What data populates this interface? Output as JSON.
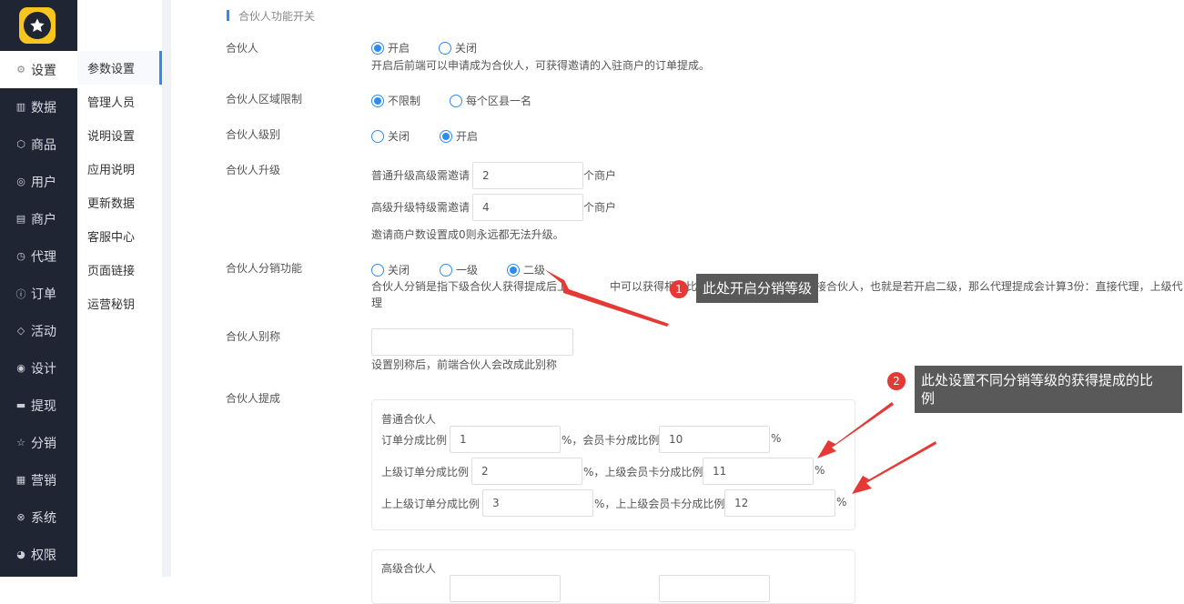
{
  "sidebar": {
    "items": [
      {
        "label": "设置",
        "icon": "gear-icon",
        "glyph": "⚙"
      },
      {
        "label": "数据",
        "icon": "bar-chart-icon",
        "glyph": "▥"
      },
      {
        "label": "商品",
        "icon": "cube-icon",
        "glyph": "⬡"
      },
      {
        "label": "用户",
        "icon": "user-icon",
        "glyph": "◎"
      },
      {
        "label": "商户",
        "icon": "store-icon",
        "glyph": "▤"
      },
      {
        "label": "代理",
        "icon": "clock-icon",
        "glyph": "◷"
      },
      {
        "label": "订单",
        "icon": "info-icon",
        "glyph": "ⓘ"
      },
      {
        "label": "活动",
        "icon": "tag-icon",
        "glyph": "◇"
      },
      {
        "label": "设计",
        "icon": "palette-icon",
        "glyph": "◉"
      },
      {
        "label": "提现",
        "icon": "card-icon",
        "glyph": "▬"
      },
      {
        "label": "分销",
        "icon": "star-icon",
        "glyph": "☆"
      },
      {
        "label": "营销",
        "icon": "grid-icon",
        "glyph": "▦"
      },
      {
        "label": "系统",
        "icon": "cross-circle-icon",
        "glyph": "⊗"
      },
      {
        "label": "权限",
        "icon": "compass-icon",
        "glyph": "◕"
      }
    ]
  },
  "submenu": {
    "items": [
      "参数设置",
      "管理人员",
      "说明设置",
      "应用说明",
      "更新数据",
      "客服中心",
      "页面链接",
      "运营秘钥"
    ]
  },
  "section_title": "合伙人功能开关",
  "partner": {
    "label": "合伙人",
    "options": [
      "开启",
      "关闭"
    ],
    "selected": 0,
    "hint": "开启后前端可以申请成为合伙人，可获得邀请的入驻商户的订单提成。"
  },
  "region_limit": {
    "label": "合伙人区域限制",
    "options": [
      "不限制",
      "每个区县一名"
    ],
    "selected": 0
  },
  "level": {
    "label": "合伙人级别",
    "options": [
      "关闭",
      "开启"
    ],
    "selected": 1
  },
  "upgrade": {
    "label": "合伙人升级",
    "normal_label": "普通升级高级需邀请",
    "normal_value": "2",
    "advanced_label": "高级升级特级需邀请",
    "advanced_value": "4",
    "unit": "个商户",
    "hint": "邀请商户数设置成0则永远都无法升级。"
  },
  "distribution": {
    "label": "合伙人分销功能",
    "options": [
      "关闭",
      "一级",
      "二级"
    ],
    "selected": 2,
    "hint_left": "合伙人分销是指下级合伙人获得提成后上",
    "hint_mid": "中可以获得相应比例",
    "hint_right": "接合伙人，也就是若开启二级，那么代理提成会计算3份：直接代理，上级代",
    "hint_line2": "理"
  },
  "alias": {
    "label": "合伙人别称",
    "value": "",
    "hint": "设置别称后，前端合伙人会改成此别称"
  },
  "commission": {
    "label": "合伙人提成",
    "normal": {
      "title": "普通合伙人",
      "order_label": "订单分成比例",
      "order_value": "1",
      "card_label": "%，会员卡分成比例",
      "card_value": "10",
      "up_order_label": "上级订单分成比例",
      "up_order_value": "2",
      "up_card_label": "%，上级会员卡分成比例",
      "up_card_value": "11",
      "upup_order_label": "上上级订单分成比例",
      "upup_order_value": "3",
      "upup_card_label": "%，上上级会员卡分成比例",
      "upup_card_value": "12",
      "percent": "%"
    },
    "advanced": {
      "title": "高级合伙人"
    }
  },
  "annotations": {
    "tip1": "此处开启分销等级",
    "badge1": "1",
    "tip2_line1": "此处设置不同分销等级的获得提成的比",
    "tip2_line2": "例",
    "badge2": "2",
    "color": "#e53935"
  }
}
